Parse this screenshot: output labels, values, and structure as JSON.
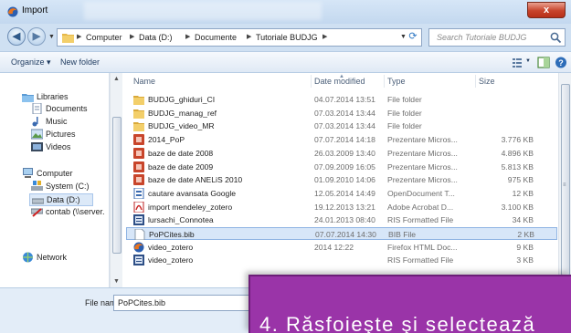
{
  "window": {
    "title": "Import",
    "close_label": "x",
    "accent": "#c7432b"
  },
  "address": {
    "breadcrumbs": [
      "Computer",
      "Data (D:)",
      "Documente",
      "Tutoriale BUDJG"
    ],
    "search_placeholder": "Search Tutoriale BUDJG"
  },
  "toolbar": {
    "organize_label": "Organize ▾",
    "new_folder_label": "New folder"
  },
  "nav": {
    "items": [
      {
        "label": "Libraries",
        "icon": "libraries-icon"
      },
      {
        "label": "Documents",
        "icon": "documents-icon"
      },
      {
        "label": "Music",
        "icon": "music-icon"
      },
      {
        "label": "Pictures",
        "icon": "pictures-icon"
      },
      {
        "label": "Videos",
        "icon": "videos-icon"
      },
      {
        "label": "Computer",
        "icon": "computer-icon"
      },
      {
        "label": "System (C:)",
        "icon": "drive-icon"
      },
      {
        "label": "Data (D:)",
        "icon": "drive-icon"
      },
      {
        "label": "contab (\\\\server.",
        "icon": "network-drive-icon"
      },
      {
        "label": "Network",
        "icon": "network-icon"
      }
    ]
  },
  "columns": {
    "name": "Name",
    "date": "Date modified",
    "type": "Type",
    "size": "Size"
  },
  "files": [
    {
      "name": "BUDJG_ghiduri_CI",
      "date": "04.07.2014 13:51",
      "type": "File folder",
      "size": "",
      "icon": "folder-icon"
    },
    {
      "name": "BUDJG_manag_ref",
      "date": "07.03.2014 13:44",
      "type": "File folder",
      "size": "",
      "icon": "folder-icon"
    },
    {
      "name": "BUDJG_video_MR",
      "date": "07.03.2014 13:44",
      "type": "File folder",
      "size": "",
      "icon": "folder-icon"
    },
    {
      "name": "2014_PoP",
      "date": "07.07.2014 14:18",
      "type": "Prezentare Micros...",
      "size": "3.776 KB",
      "icon": "powerpoint-icon"
    },
    {
      "name": "baze de date 2008",
      "date": "26.03.2009 13:40",
      "type": "Prezentare Micros...",
      "size": "4.896 KB",
      "icon": "powerpoint-icon"
    },
    {
      "name": "baze de date 2009",
      "date": "07.09.2009 16:05",
      "type": "Prezentare Micros...",
      "size": "5.813 KB",
      "icon": "powerpoint-icon"
    },
    {
      "name": "baze de date ANELiS 2010",
      "date": "01.09.2010 14:06",
      "type": "Prezentare Micros...",
      "size": "975 KB",
      "icon": "powerpoint-icon"
    },
    {
      "name": "cautare avansata Google",
      "date": "12.05.2014 14:49",
      "type": "OpenDocument T...",
      "size": "12 KB",
      "icon": "odt-icon"
    },
    {
      "name": "import mendeley_zotero",
      "date": "19.12.2013 13:21",
      "type": "Adobe Acrobat D...",
      "size": "3.100 KB",
      "icon": "pdf-icon"
    },
    {
      "name": "lursachi_Connotea",
      "date": "24.01.2013 08:40",
      "type": "RIS Formatted File",
      "size": "34 KB",
      "icon": "ris-icon"
    },
    {
      "name": "PoPCites.bib",
      "date": "07.07.2014 14:30",
      "type": "BIB File",
      "size": "2 KB",
      "icon": "file-icon",
      "selected": true
    },
    {
      "name": "video_zotero",
      "date": "2014 12:22",
      "type": "Firefox HTML Doc...",
      "size": "9 KB",
      "icon": "firefox-icon"
    },
    {
      "name": "video_zotero",
      "date": "",
      "type": "RIS Formatted File",
      "size": "3 KB",
      "icon": "ris-icon"
    }
  ],
  "filename": {
    "label": "File name:",
    "value": "PoPCites.bib"
  },
  "callout": {
    "text": "4. Răsfoieşte şi selectează",
    "color": "#9a34a8"
  }
}
